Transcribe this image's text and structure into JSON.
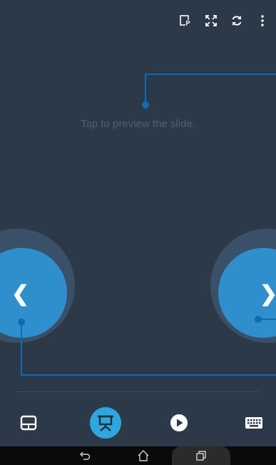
{
  "toolbar": {
    "icons": [
      "presenter-notes-icon",
      "fullscreen-icon",
      "refresh-icon",
      "more-vert-icon"
    ]
  },
  "main": {
    "hint": "Tap to preview the slide."
  },
  "navigation": {
    "prev_icon": "chevron-left-icon",
    "next_icon": "chevron-right-icon",
    "prev_glyph": "❮",
    "next_glyph": "❯"
  },
  "bottom_tabs": {
    "items": [
      "touchpad-tab",
      "presentation-tab",
      "play-tab",
      "keyboard-tab"
    ],
    "active": "presentation-tab"
  },
  "system_nav": {
    "back_icon": "back-icon",
    "home_icon": "home-icon",
    "recents_icon": "recents-icon"
  },
  "colors": {
    "background": "#2b3948",
    "accent": "#30a6de",
    "guide": "#0f6bb8",
    "hint_text": "#4f6070"
  }
}
